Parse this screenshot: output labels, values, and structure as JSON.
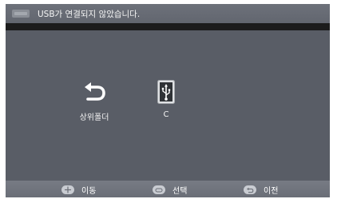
{
  "top_bar": {
    "message": "USB가 연결되지 않았습니다."
  },
  "items": [
    {
      "label": "상위폴더",
      "icon": "return-arrow-icon"
    },
    {
      "label": "C",
      "icon": "usb-drive-icon"
    }
  ],
  "bottom_bar": {
    "hints": [
      {
        "label": "이동",
        "icon": "dpad-icon"
      },
      {
        "label": "선택",
        "icon": "ok-button-icon"
      },
      {
        "label": "이전",
        "icon": "back-button-icon"
      }
    ]
  },
  "colors": {
    "background": "#595d66",
    "top_bar": "#686c75",
    "black_strip": "#1c1c1c",
    "bottom_bar": "#70747d",
    "text": "#ffffff"
  }
}
